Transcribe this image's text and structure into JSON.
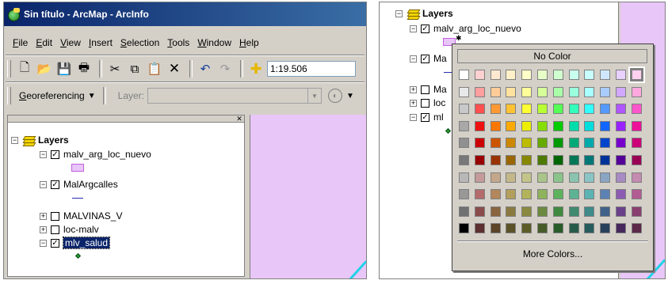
{
  "window": {
    "title": "Sin título - ArcMap - ArcInfo"
  },
  "menu": [
    "File",
    "Edit",
    "View",
    "Insert",
    "Selection",
    "Tools",
    "Window",
    "Help"
  ],
  "toolbar": {
    "scale": "1:19.506"
  },
  "georef": {
    "label": "Georeferencing",
    "layer_label": "Layer:"
  },
  "toc": {
    "root": "Layers",
    "layers": [
      {
        "name": "malv_arg_loc_nuevo",
        "checked": true,
        "expanded": true,
        "symbol": "polygon"
      },
      {
        "name": "MalArgcalles",
        "checked": true,
        "expanded": true,
        "symbol": "line"
      },
      {
        "name": "MALVINAS_V",
        "checked": false,
        "expanded": false
      },
      {
        "name": "loc-malv",
        "checked": false,
        "expanded": false
      },
      {
        "name": "mlv_salud",
        "checked": true,
        "expanded": true,
        "symbol": "point",
        "selected": true
      }
    ]
  },
  "right_toc": {
    "root": "Layers",
    "layers": [
      "malv_arg_loc_nuevo",
      "Ma",
      "Ma",
      "loc",
      "ml"
    ]
  },
  "palette": {
    "no_color_label": "No Color",
    "more_colors_label": "More Colors...",
    "selected_swatch": [
      0,
      11
    ],
    "rows": [
      [
        "#ffffff",
        "#ffd0d0",
        "#ffe8d0",
        "#fff0c8",
        "#ffffc8",
        "#e8ffc8",
        "#d0ffd0",
        "#c8ffee",
        "#c8ffff",
        "#d0e8ff",
        "#e8d0ff",
        "#ffd0f0"
      ],
      [
        "#e8e8e8",
        "#ff9e9e",
        "#ffcc99",
        "#ffe29e",
        "#ffff99",
        "#d6ff99",
        "#a8ffa8",
        "#99ffdd",
        "#a8ffff",
        "#a8ccff",
        "#d2a8ff",
        "#ffa8e0"
      ],
      [
        "#c8c8c8",
        "#ff5050",
        "#ff9933",
        "#ffc233",
        "#ffff33",
        "#b8ff33",
        "#55ff55",
        "#33ffbb",
        "#33ffff",
        "#5599ff",
        "#b055ff",
        "#ff55cc"
      ],
      [
        "#a8a8a8",
        "#ee1111",
        "#ff7700",
        "#ffaa00",
        "#eeee00",
        "#88dd00",
        "#00cc00",
        "#00ddaa",
        "#00dddd",
        "#1166ff",
        "#9922ff",
        "#ee1199"
      ],
      [
        "#909090",
        "#cc0000",
        "#cc5500",
        "#cc8800",
        "#bbbb00",
        "#66aa00",
        "#009900",
        "#00aa77",
        "#00aaaa",
        "#0044cc",
        "#7700cc",
        "#cc0077"
      ],
      [
        "#787878",
        "#990000",
        "#993300",
        "#996600",
        "#888800",
        "#4d7a00",
        "#006600",
        "#007755",
        "#007777",
        "#003399",
        "#550099",
        "#990055"
      ],
      [
        "#b8b8b8",
        "#c49a9a",
        "#c4a78a",
        "#c4b88a",
        "#c4c48a",
        "#aac48a",
        "#8ac48a",
        "#8ac4b0",
        "#8ac4c4",
        "#8aa5c4",
        "#a88ac4",
        "#c48ab0"
      ],
      [
        "#989898",
        "#b36b6b",
        "#b3875c",
        "#b39f5c",
        "#b3b35c",
        "#8eb35c",
        "#5cb35c",
        "#5cb394",
        "#5cb3b3",
        "#5c82b3",
        "#8c5cb3",
        "#b35c94"
      ],
      [
        "#707070",
        "#8a4c4c",
        "#8a6540",
        "#8a7a40",
        "#8a8a40",
        "#6b8a40",
        "#408a40",
        "#408a70",
        "#408a8a",
        "#40628a",
        "#6a408a",
        "#8a4070"
      ],
      [
        "#000000",
        "#5c3030",
        "#5c4428",
        "#5c5228",
        "#5c5c28",
        "#465c28",
        "#285c28",
        "#285c4a",
        "#285c5c",
        "#28405c",
        "#46285c",
        "#5c284a"
      ]
    ]
  }
}
